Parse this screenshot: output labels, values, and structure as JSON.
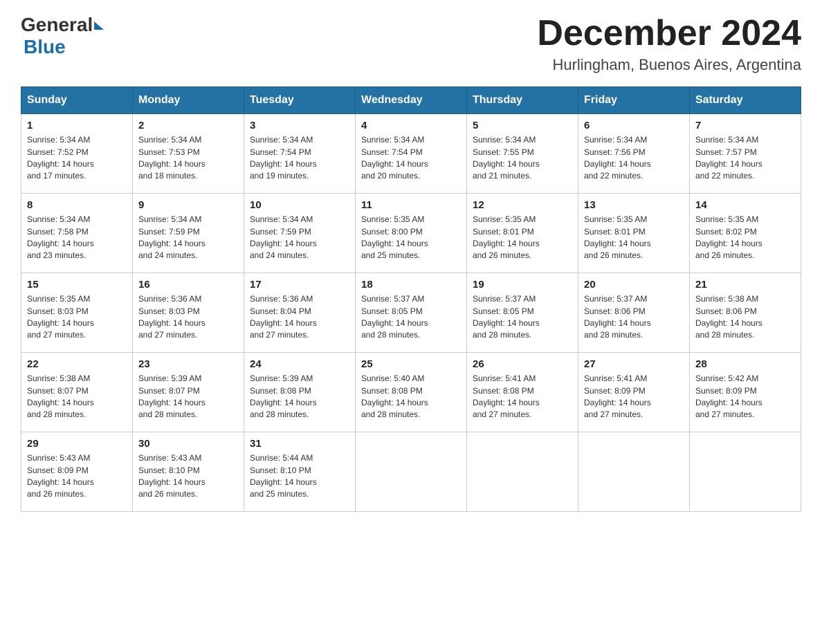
{
  "header": {
    "logo_general": "General",
    "logo_blue": "Blue",
    "month_title": "December 2024",
    "location": "Hurlingham, Buenos Aires, Argentina"
  },
  "days_of_week": [
    "Sunday",
    "Monday",
    "Tuesday",
    "Wednesday",
    "Thursday",
    "Friday",
    "Saturday"
  ],
  "weeks": [
    [
      {
        "num": "1",
        "sunrise": "5:34 AM",
        "sunset": "7:52 PM",
        "daylight": "14 hours and 17 minutes."
      },
      {
        "num": "2",
        "sunrise": "5:34 AM",
        "sunset": "7:53 PM",
        "daylight": "14 hours and 18 minutes."
      },
      {
        "num": "3",
        "sunrise": "5:34 AM",
        "sunset": "7:54 PM",
        "daylight": "14 hours and 19 minutes."
      },
      {
        "num": "4",
        "sunrise": "5:34 AM",
        "sunset": "7:54 PM",
        "daylight": "14 hours and 20 minutes."
      },
      {
        "num": "5",
        "sunrise": "5:34 AM",
        "sunset": "7:55 PM",
        "daylight": "14 hours and 21 minutes."
      },
      {
        "num": "6",
        "sunrise": "5:34 AM",
        "sunset": "7:56 PM",
        "daylight": "14 hours and 22 minutes."
      },
      {
        "num": "7",
        "sunrise": "5:34 AM",
        "sunset": "7:57 PM",
        "daylight": "14 hours and 22 minutes."
      }
    ],
    [
      {
        "num": "8",
        "sunrise": "5:34 AM",
        "sunset": "7:58 PM",
        "daylight": "14 hours and 23 minutes."
      },
      {
        "num": "9",
        "sunrise": "5:34 AM",
        "sunset": "7:59 PM",
        "daylight": "14 hours and 24 minutes."
      },
      {
        "num": "10",
        "sunrise": "5:34 AM",
        "sunset": "7:59 PM",
        "daylight": "14 hours and 24 minutes."
      },
      {
        "num": "11",
        "sunrise": "5:35 AM",
        "sunset": "8:00 PM",
        "daylight": "14 hours and 25 minutes."
      },
      {
        "num": "12",
        "sunrise": "5:35 AM",
        "sunset": "8:01 PM",
        "daylight": "14 hours and 26 minutes."
      },
      {
        "num": "13",
        "sunrise": "5:35 AM",
        "sunset": "8:01 PM",
        "daylight": "14 hours and 26 minutes."
      },
      {
        "num": "14",
        "sunrise": "5:35 AM",
        "sunset": "8:02 PM",
        "daylight": "14 hours and 26 minutes."
      }
    ],
    [
      {
        "num": "15",
        "sunrise": "5:35 AM",
        "sunset": "8:03 PM",
        "daylight": "14 hours and 27 minutes."
      },
      {
        "num": "16",
        "sunrise": "5:36 AM",
        "sunset": "8:03 PM",
        "daylight": "14 hours and 27 minutes."
      },
      {
        "num": "17",
        "sunrise": "5:36 AM",
        "sunset": "8:04 PM",
        "daylight": "14 hours and 27 minutes."
      },
      {
        "num": "18",
        "sunrise": "5:37 AM",
        "sunset": "8:05 PM",
        "daylight": "14 hours and 28 minutes."
      },
      {
        "num": "19",
        "sunrise": "5:37 AM",
        "sunset": "8:05 PM",
        "daylight": "14 hours and 28 minutes."
      },
      {
        "num": "20",
        "sunrise": "5:37 AM",
        "sunset": "8:06 PM",
        "daylight": "14 hours and 28 minutes."
      },
      {
        "num": "21",
        "sunrise": "5:38 AM",
        "sunset": "8:06 PM",
        "daylight": "14 hours and 28 minutes."
      }
    ],
    [
      {
        "num": "22",
        "sunrise": "5:38 AM",
        "sunset": "8:07 PM",
        "daylight": "14 hours and 28 minutes."
      },
      {
        "num": "23",
        "sunrise": "5:39 AM",
        "sunset": "8:07 PM",
        "daylight": "14 hours and 28 minutes."
      },
      {
        "num": "24",
        "sunrise": "5:39 AM",
        "sunset": "8:08 PM",
        "daylight": "14 hours and 28 minutes."
      },
      {
        "num": "25",
        "sunrise": "5:40 AM",
        "sunset": "8:08 PM",
        "daylight": "14 hours and 28 minutes."
      },
      {
        "num": "26",
        "sunrise": "5:41 AM",
        "sunset": "8:08 PM",
        "daylight": "14 hours and 27 minutes."
      },
      {
        "num": "27",
        "sunrise": "5:41 AM",
        "sunset": "8:09 PM",
        "daylight": "14 hours and 27 minutes."
      },
      {
        "num": "28",
        "sunrise": "5:42 AM",
        "sunset": "8:09 PM",
        "daylight": "14 hours and 27 minutes."
      }
    ],
    [
      {
        "num": "29",
        "sunrise": "5:43 AM",
        "sunset": "8:09 PM",
        "daylight": "14 hours and 26 minutes."
      },
      {
        "num": "30",
        "sunrise": "5:43 AM",
        "sunset": "8:10 PM",
        "daylight": "14 hours and 26 minutes."
      },
      {
        "num": "31",
        "sunrise": "5:44 AM",
        "sunset": "8:10 PM",
        "daylight": "14 hours and 25 minutes."
      },
      null,
      null,
      null,
      null
    ]
  ],
  "labels": {
    "sunrise": "Sunrise:",
    "sunset": "Sunset:",
    "daylight": "Daylight:"
  }
}
